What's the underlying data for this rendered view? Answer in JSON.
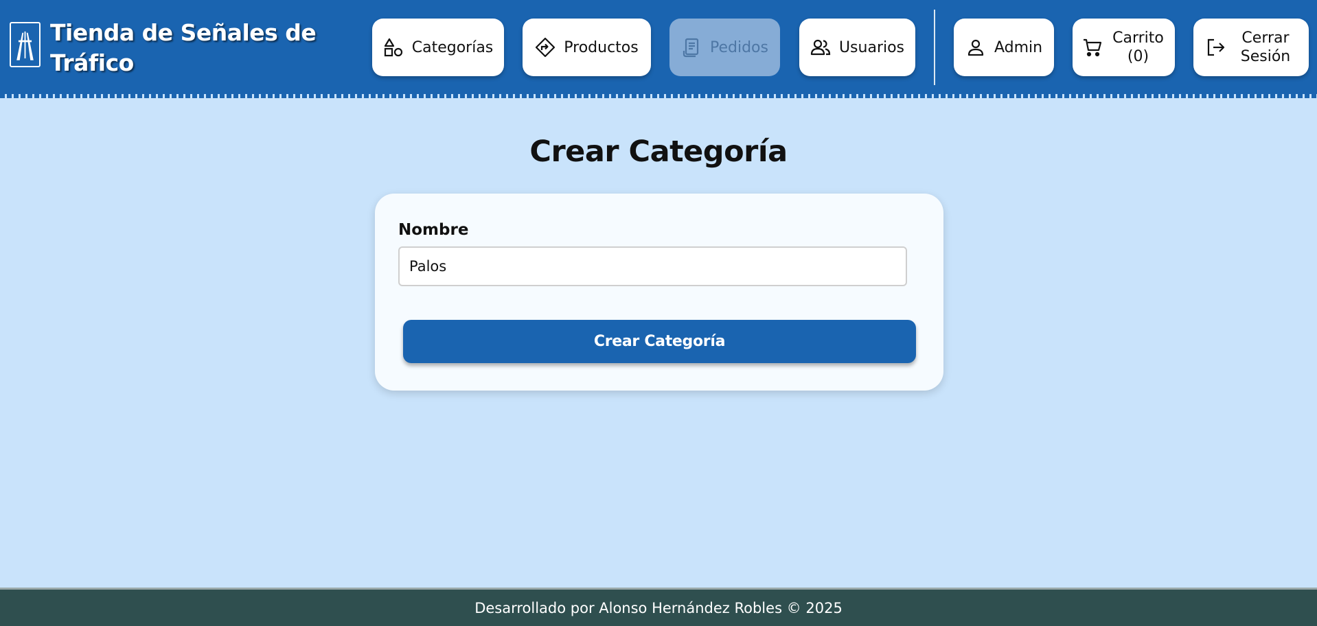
{
  "header": {
    "title": "Tienda de Señales de Tráfico",
    "logo_icon": "highway-sign-icon"
  },
  "nav": {
    "categorias": {
      "label": "Categorías",
      "icon": "shapes-icon"
    },
    "productos": {
      "label": "Productos",
      "icon": "directions-sign-icon"
    },
    "pedidos": {
      "label": "Pedidos",
      "icon": "receipt-icon",
      "disabled": true
    },
    "usuarios": {
      "label": "Usuarios",
      "icon": "users-icon"
    },
    "admin": {
      "label": "Admin",
      "icon": "user-icon"
    },
    "carrito": {
      "label": "Carrito (0)",
      "icon": "cart-icon"
    },
    "logout": {
      "label": "Cerrar Sesión",
      "icon": "logout-icon"
    }
  },
  "page": {
    "title": "Crear Categoría"
  },
  "form": {
    "name_label": "Nombre",
    "name_value": "Palos",
    "submit_label": "Crear Categoría"
  },
  "footer": {
    "text": "Desarrollado por Alonso Hernández Robles © 2025"
  },
  "colors": {
    "header_bg": "#1a64b0",
    "page_bg": "#c9e3fb",
    "card_bg": "#f6fbff",
    "primary_button": "#1a64b0",
    "footer_bg": "#2f4f4f",
    "disabled_button": "#86acd6"
  }
}
